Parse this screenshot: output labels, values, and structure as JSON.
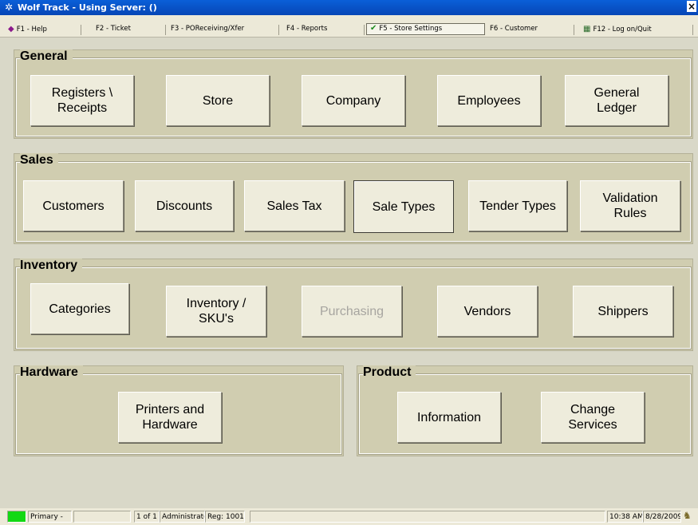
{
  "window": {
    "title": "Wolf Track - Using Server: ()",
    "close_label": "×"
  },
  "fkeys": [
    {
      "label": "F1 - Help",
      "icon": "help-book-icon"
    },
    {
      "label": "F2 - Ticket"
    },
    {
      "label": "F3 - POReceiving/Xfer"
    },
    {
      "label": "F4 - Reports"
    },
    {
      "label": "F5 - Store Settings",
      "icon": "checkmark-icon",
      "active": true
    },
    {
      "label": "F6 - Customer"
    },
    {
      "label": "F12 - Log on/Quit",
      "icon": "logoff-icon"
    }
  ],
  "groups": {
    "general": {
      "label": "General",
      "buttons": [
        "Registers \\\nReceipts",
        "Store",
        "Company",
        "Employees",
        "General\nLedger"
      ]
    },
    "sales": {
      "label": "Sales",
      "buttons": [
        "Customers",
        "Discounts",
        "Sales Tax",
        "Sale Types",
        "Tender Types",
        "Validation\nRules"
      ]
    },
    "inventory": {
      "label": "Inventory",
      "buttons": [
        "Categories",
        "Inventory /\nSKU's",
        "Purchasing",
        "Vendors",
        "Shippers"
      ]
    },
    "hardware": {
      "label": "Hardware",
      "buttons": [
        "Printers and\nHardware"
      ]
    },
    "product": {
      "label": "Product",
      "buttons": [
        "Information",
        "Change\nServices"
      ]
    }
  },
  "status": {
    "connection": "Primary -",
    "page": "1 of 1",
    "user": "Administrator",
    "register": "Reg: 1001",
    "time": "10:38 AM",
    "date": "8/28/2009",
    "status_color": "#13d813"
  }
}
